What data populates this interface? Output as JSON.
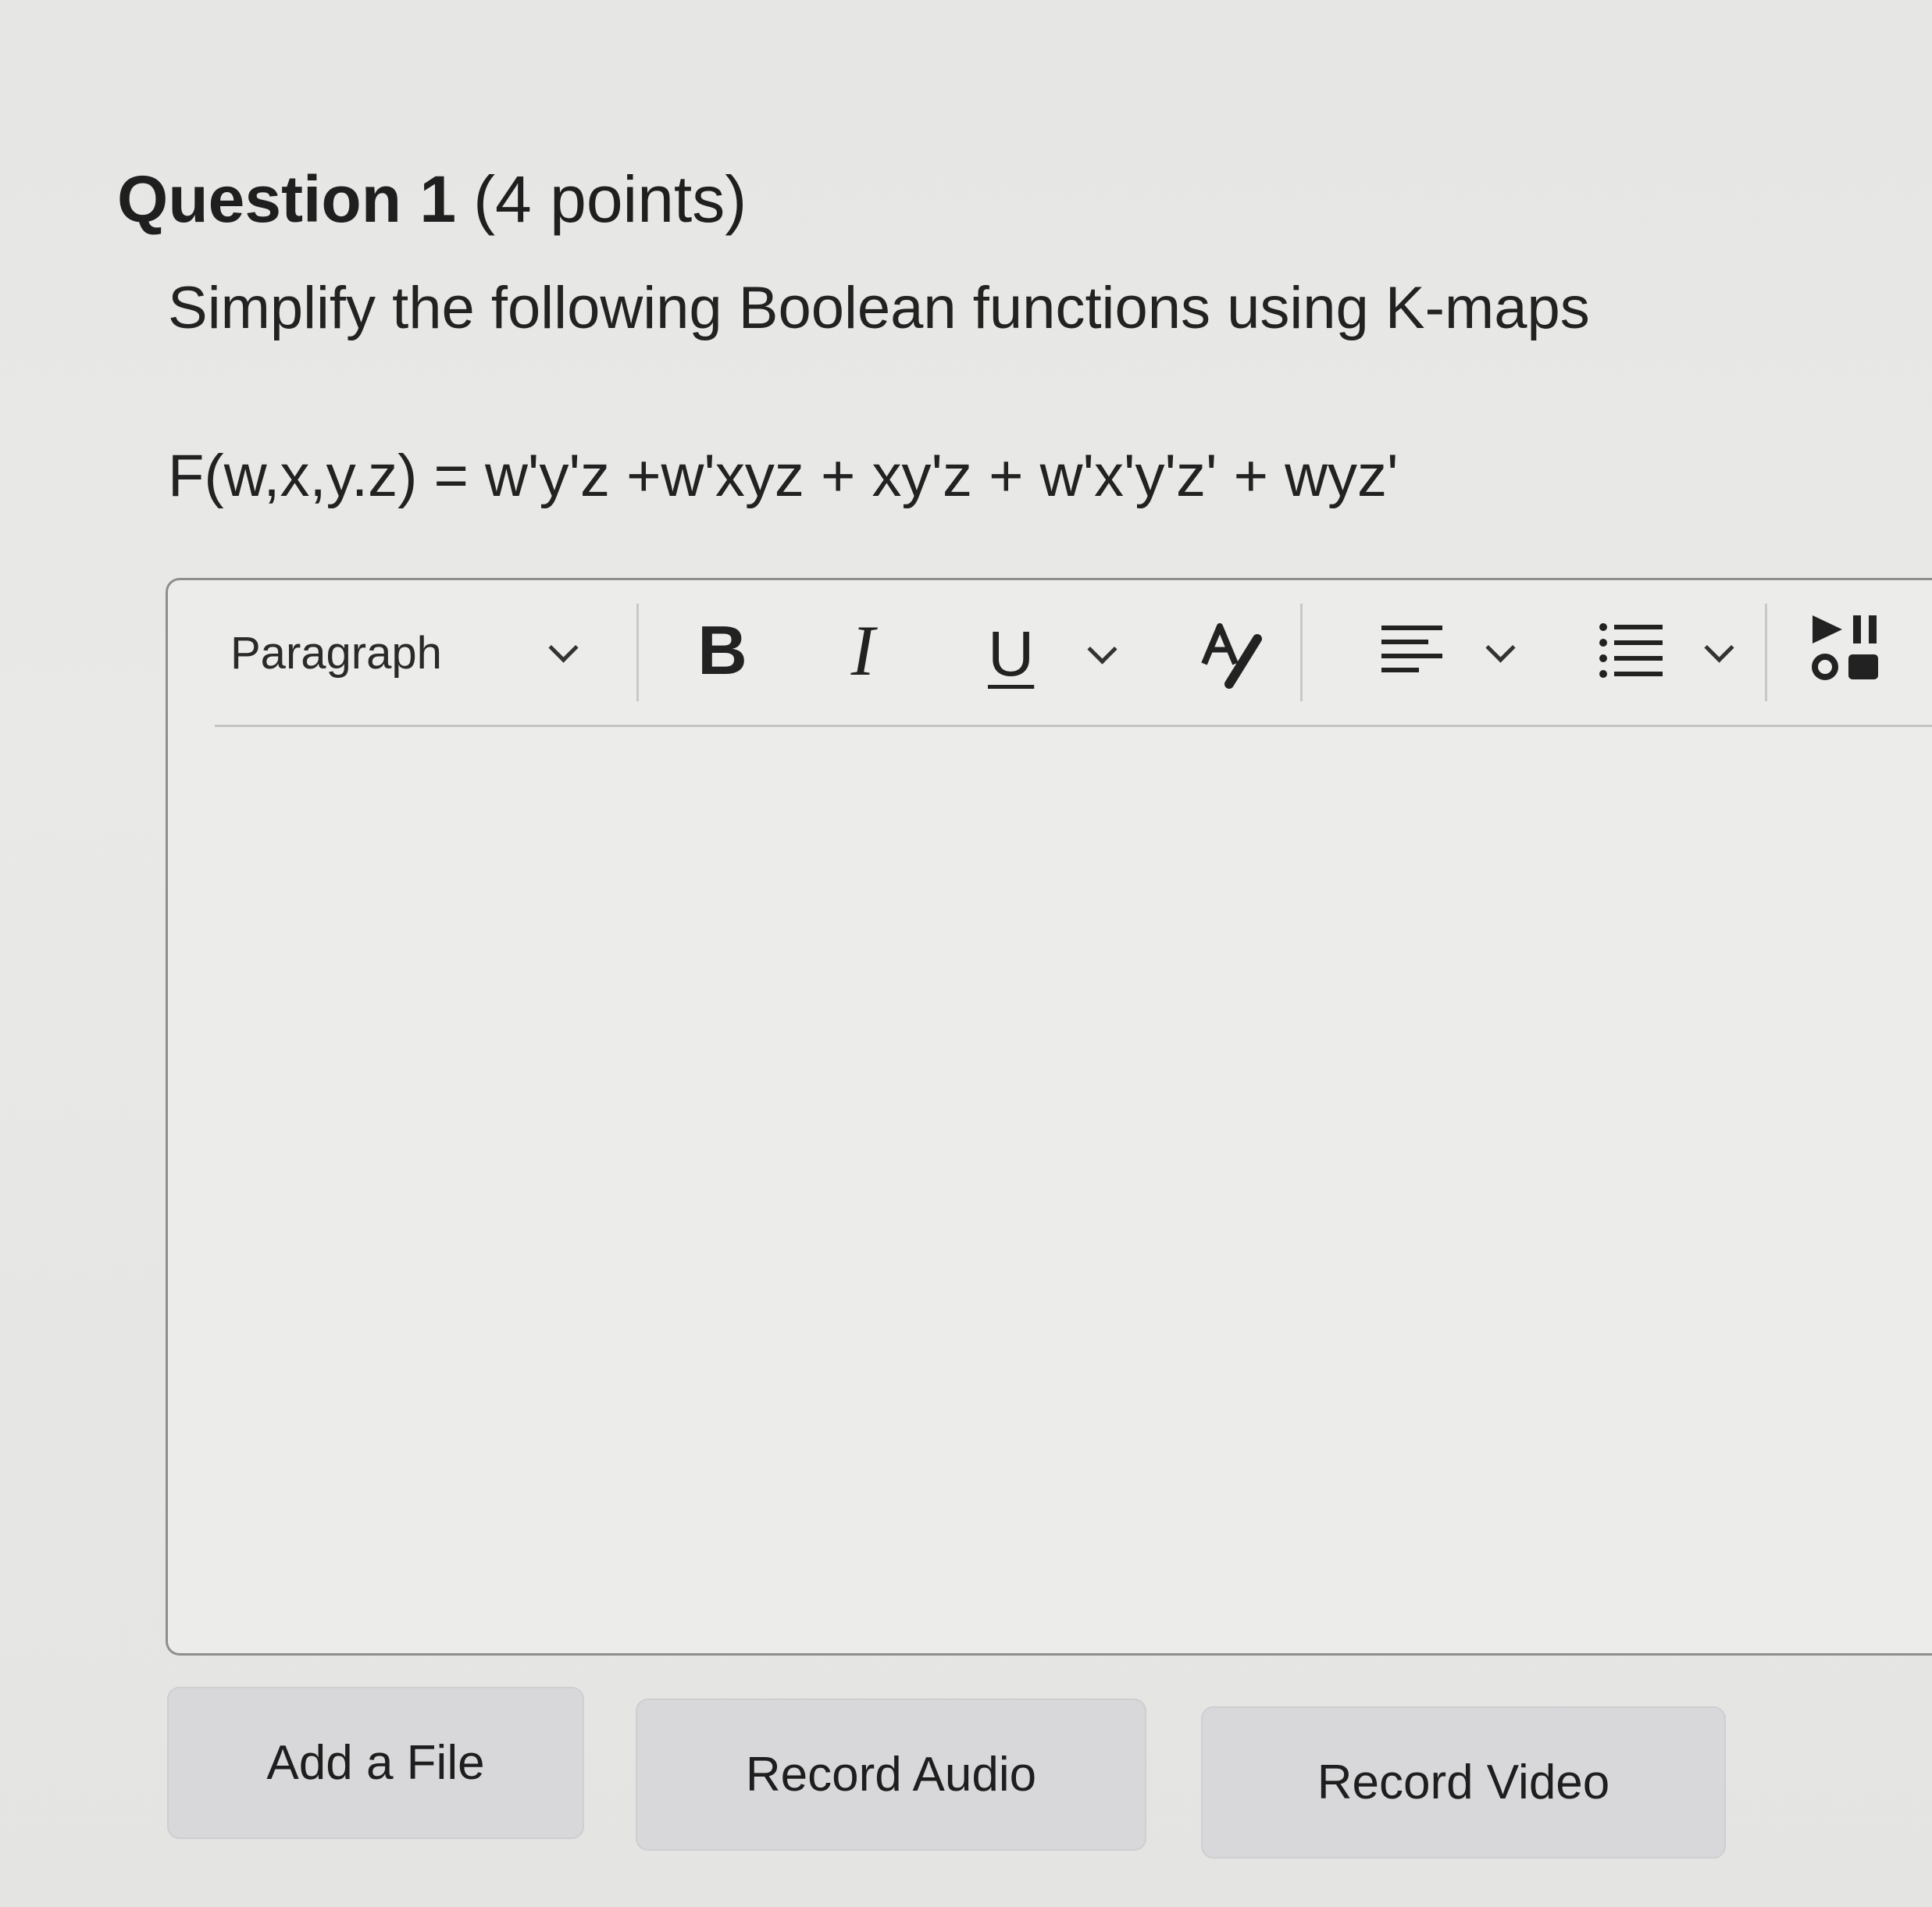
{
  "question": {
    "title": "Question 1",
    "points": "(4 points)",
    "prompt": "Simplify the following Boolean functions using K-maps",
    "formula": "F(w,x,y.z) =  w'y'z +w'xyz + xy'z + w'x'y'z' + wyz'"
  },
  "editor": {
    "toolbar": {
      "block_format": "Paragraph",
      "bold_label": "B",
      "italic_label": "I",
      "underline_label": "U",
      "icons": [
        "chevron-down-icon",
        "bold-icon",
        "italic-icon",
        "underline-icon",
        "font-color-icon",
        "align-icon",
        "list-icon",
        "media-icon"
      ]
    },
    "content": ""
  },
  "actions": {
    "add_file": "Add a File",
    "record_audio": "Record Audio",
    "record_video": "Record Video"
  }
}
